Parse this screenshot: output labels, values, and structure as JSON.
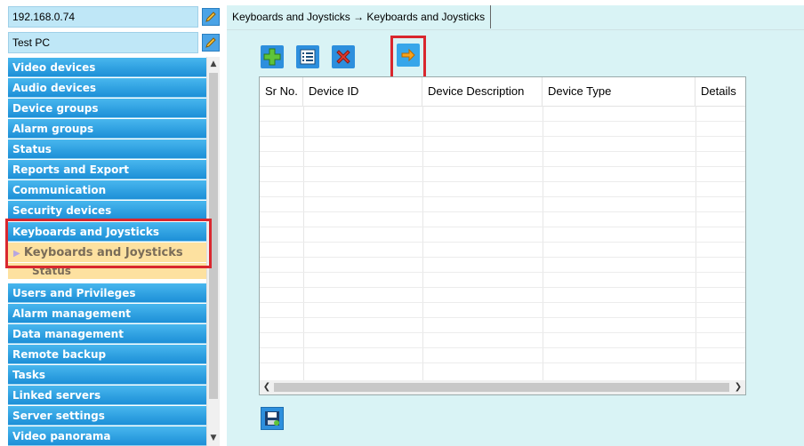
{
  "server": {
    "address": "192.168.0.74",
    "pc_name": "Test PC"
  },
  "icons": {
    "edit": "pencil-icon",
    "add": "plus-icon",
    "list": "list-icon",
    "delete": "x-delete-icon",
    "export": "arrow-right-icon",
    "save": "floppy-save-icon"
  },
  "menu": [
    "Video devices",
    "Audio devices",
    "Device groups",
    "Alarm groups",
    "Status",
    "Reports and Export",
    "Communication",
    "Security devices",
    "Keyboards and Joysticks"
  ],
  "submenu": {
    "active": "Keyboards and Joysticks",
    "status": "Status"
  },
  "menu_after": [
    "Users and Privileges",
    "Alarm management",
    "Data management",
    "Remote backup",
    "Tasks",
    "Linked servers",
    "Server settings",
    "Video panorama"
  ],
  "tab": {
    "title": "Keyboards and Joysticks → Keyboards and Joysticks"
  },
  "table": {
    "columns": [
      "Sr No.",
      "Device ID",
      "Device Description",
      "Device Type",
      "Details"
    ]
  },
  "colors": {
    "menu_blue": "#1d8fd7",
    "highlight_red": "#d9272e",
    "sub_selected": "#fde1a0",
    "panel_bg": "#d9f3f5"
  }
}
